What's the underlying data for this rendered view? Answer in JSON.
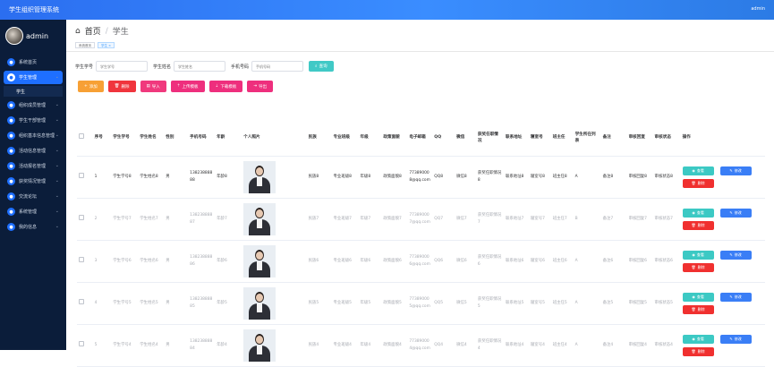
{
  "app": {
    "title": "学生组织管理系统",
    "user": "admin"
  },
  "sidebar": {
    "username": "admin",
    "items": [
      {
        "label": "系统首页",
        "icon": "home-icon",
        "expandable": false,
        "active": false
      },
      {
        "label": "学生管理",
        "icon": "users-icon",
        "expandable": true,
        "active": true
      },
      {
        "label": "组织成员管理",
        "icon": "group-icon",
        "expandable": true,
        "active": false
      },
      {
        "label": "学生干部管理",
        "icon": "user-badge-icon",
        "expandable": true,
        "active": false
      },
      {
        "label": "组织基本信息管理",
        "icon": "info-icon",
        "expandable": true,
        "active": false
      },
      {
        "label": "活动信息管理",
        "icon": "calendar-icon",
        "expandable": true,
        "active": false
      },
      {
        "label": "活动报名管理",
        "icon": "signup-icon",
        "expandable": true,
        "active": false
      },
      {
        "label": "获奖情况管理",
        "icon": "trophy-icon",
        "expandable": true,
        "active": false
      },
      {
        "label": "交流论坛",
        "icon": "chat-icon",
        "expandable": true,
        "active": false
      },
      {
        "label": "系统管理",
        "icon": "gear-icon",
        "expandable": true,
        "active": false
      },
      {
        "label": "我的信息",
        "icon": "person-icon",
        "expandable": true,
        "active": false
      }
    ],
    "sub_item": "学生"
  },
  "breadcrumb": {
    "home": "首页",
    "current": "学生"
  },
  "tags": [
    {
      "label": "系统首页",
      "active": false
    },
    {
      "label": "学生",
      "active": true
    }
  ],
  "search": {
    "fields": [
      {
        "label": "学生学号",
        "placeholder": "学生学号"
      },
      {
        "label": "学生姓名",
        "placeholder": "学生姓名"
      },
      {
        "label": "手机号码",
        "placeholder": "手机号码"
      }
    ],
    "button": "查询"
  },
  "toolbar": {
    "add": "添加",
    "delete": "删除",
    "import": "导入",
    "upload_template": "上传模板",
    "download_template": "下载模板",
    "export": "导出"
  },
  "table": {
    "headers": [
      "序号",
      "学生学号",
      "学生姓名",
      "性别",
      "手机号码",
      "年龄",
      "个人照片",
      "民族",
      "专业班级",
      "年级",
      "政策面貌",
      "电子邮箱",
      "QQ",
      "微信",
      "获奖任职情况",
      "联系地址",
      "寝室号",
      "班主任",
      "学生所在列表",
      "备注",
      "审核回复",
      "审核状态",
      "操作"
    ],
    "rows": [
      {
        "no": "1",
        "student_no": "学生学号8",
        "name": "学生姓名8",
        "gender": "男",
        "phone": "13823888888",
        "age": "年龄8",
        "ethnic": "民族8",
        "class": "专业班级8",
        "grade": "年级8",
        "politics": "政策面貌8",
        "email": "773890008@qq.com",
        "qq": "QQ8",
        "wechat": "微信8",
        "awards": "获奖任职情况8",
        "address": "联系地址8",
        "dorm": "寝室号8",
        "teacher": "班主任8",
        "list": "A",
        "remark": "备注8",
        "reply": "审核回复8",
        "status": "审核状态8"
      },
      {
        "no": "2",
        "student_no": "学生学号7",
        "name": "学生姓名7",
        "gender": "男",
        "phone": "13823888887",
        "age": "年龄7",
        "ethnic": "民族7",
        "class": "专业班级7",
        "grade": "年级7",
        "politics": "政策面貌7",
        "email": "773890007@qq.com",
        "qq": "QQ7",
        "wechat": "微信7",
        "awards": "获奖任职情况7",
        "address": "联系地址7",
        "dorm": "寝室号7",
        "teacher": "班主任7",
        "list": "B",
        "remark": "备注7",
        "reply": "审核回复7",
        "status": "审核状态7"
      },
      {
        "no": "3",
        "student_no": "学生学号6",
        "name": "学生姓名6",
        "gender": "男",
        "phone": "13823888886",
        "age": "年龄6",
        "ethnic": "民族6",
        "class": "专业班级6",
        "grade": "年级6",
        "politics": "政策面貌6",
        "email": "773890006@qq.com",
        "qq": "QQ6",
        "wechat": "微信6",
        "awards": "获奖任职情况6",
        "address": "联系地址6",
        "dorm": "寝室号6",
        "teacher": "班主任6",
        "list": "A",
        "remark": "备注6",
        "reply": "审核回复6",
        "status": "审核状态6"
      },
      {
        "no": "4",
        "student_no": "学生学号5",
        "name": "学生姓名5",
        "gender": "男",
        "phone": "13823888885",
        "age": "年龄5",
        "ethnic": "民族5",
        "class": "专业班级5",
        "grade": "年级5",
        "politics": "政策面貌5",
        "email": "773890005@qq.com",
        "qq": "QQ5",
        "wechat": "微信5",
        "awards": "获奖任职情况5",
        "address": "联系地址5",
        "dorm": "寝室号5",
        "teacher": "班主任5",
        "list": "A",
        "remark": "备注5",
        "reply": "审核回复5",
        "status": "审核状态5"
      },
      {
        "no": "5",
        "student_no": "学生学号4",
        "name": "学生姓名4",
        "gender": "男",
        "phone": "13823888884",
        "age": "年龄4",
        "ethnic": "民族4",
        "class": "专业班级4",
        "grade": "年级4",
        "politics": "政策面貌4",
        "email": "773890004@qq.com",
        "qq": "QQ4",
        "wechat": "微信4",
        "awards": "获奖任职情况4",
        "address": "联系地址4",
        "dorm": "寝室号4",
        "teacher": "班主任4",
        "list": "A",
        "remark": "备注4",
        "reply": "审核回复4",
        "status": "审核状态4"
      }
    ],
    "actions": {
      "view": "查看",
      "edit": "修改",
      "delete": "删除"
    }
  },
  "colors": {
    "primary": "#409eff",
    "sidebar_bg": "#0b1d3a",
    "search_btn": "#40c9c6",
    "danger": "#f0302f",
    "edit": "#3a7ef6"
  }
}
